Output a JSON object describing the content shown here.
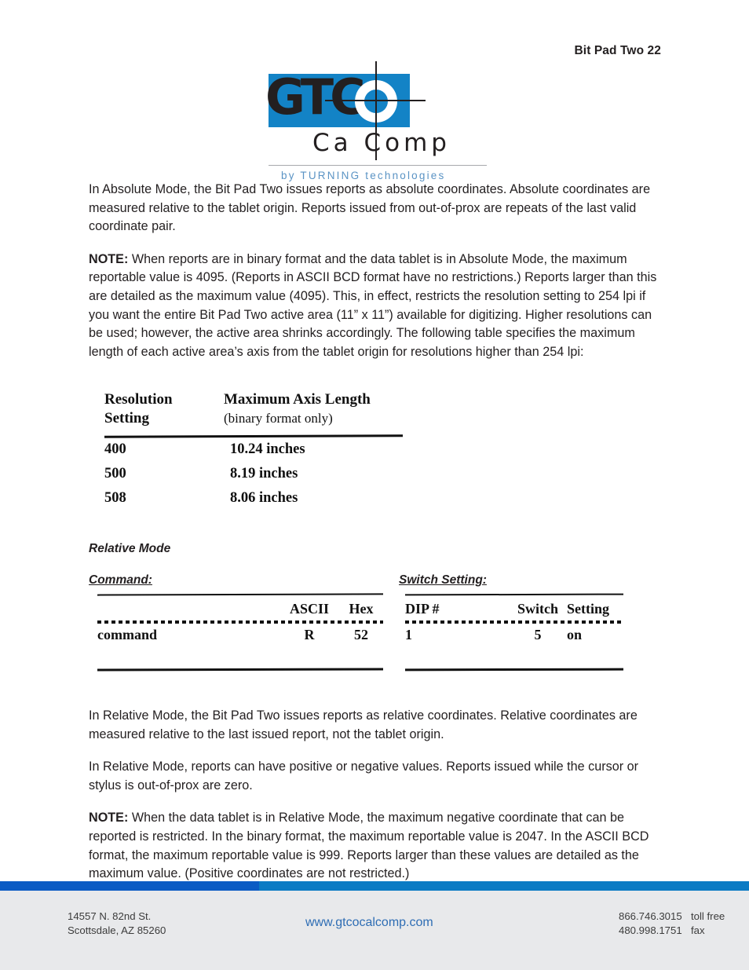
{
  "header": {
    "page_label": "Bit Pad Two 22"
  },
  "logo": {
    "wordmark": "GTC",
    "subtitle": "Ca Comp",
    "tagline_prefix": "by",
    "tagline_brand": "TURNING",
    "tagline_suffix": "technologies",
    "brand_blue": "#1383c6",
    "tagline_color": "#5a93c4"
  },
  "body": {
    "paragraph_1": "In Absolute Mode, the Bit Pad Two issues reports as absolute coordinates.  Absolute coordinates are measured relative to the tablet origin.  Reports issued from out-of-prox are repeats of the last valid coordinate pair.",
    "note_1_lead": "NOTE:",
    "note_1_text": " When reports are in binary format and the data tablet is in Absolute Mode, the maximum reportable value is 4095.  (Reports in ASCII BCD format have no restrictions.)  Reports larger than this are detailed as the maximum value (4095).  This, in effect, restricts the resolution setting to 254 lpi if you want the entire Bit Pad Two active area (11” x 11”) available for digitizing.  Higher resolutions can be used; however, the active area shrinks accordingly.  The following table specifies the maximum length of each active area’s axis from the tablet origin for resolutions higher than 254 lpi:",
    "paragraph_2": "In Relative Mode, the Bit Pad Two issues reports as relative coordinates.  Relative coordinates are measured relative to the last issued report, not the tablet origin.",
    "paragraph_3": "In Relative Mode, reports can have positive or negative values.  Reports issued while the cursor or stylus is out-of-prox are zero.",
    "note_2_lead": "NOTE:",
    "note_2_text": " When the data tablet is in Relative Mode, the maximum negative coordinate that can be reported is restricted.  In the binary format, the maximum reportable value is 2047.  In the ASCII BCD format, the maximum reportable value is 999.  Reports larger than these values are detailed as the maximum value.  (Positive coordinates are not restricted.)"
  },
  "resolution_table": {
    "header_col1_line1": "Resolution",
    "header_col1_line2": "Setting",
    "header_col2_line1": "Maximum Axis Length",
    "header_col2_line2": "(binary format only)",
    "rows": [
      {
        "setting": "400",
        "length": "10.24 inches"
      },
      {
        "setting": "500",
        "length": "8.19 inches"
      },
      {
        "setting": "508",
        "length": "8.06 inches"
      }
    ]
  },
  "sections": {
    "relative_mode_heading": "Relative Mode",
    "command_heading": "Command:",
    "switch_heading": "Switch Setting:"
  },
  "command_table": {
    "header": {
      "label": "",
      "ascii": "ASCII",
      "hex": "Hex"
    },
    "rows": [
      {
        "label": "command",
        "ascii": "R",
        "hex": "52"
      }
    ]
  },
  "switch_table": {
    "header": {
      "dip": "DIP #",
      "switch": "Switch",
      "setting": "Setting"
    },
    "rows": [
      {
        "dip": "1",
        "switch": "5",
        "setting": "on"
      }
    ]
  },
  "footer": {
    "address_line1": "14557 N. 82nd St.",
    "address_line2": "Scottsdale, AZ 85260",
    "url": "www.gtcocalcomp.com",
    "phone_1_number": "866.746.3015",
    "phone_1_label": "toll free",
    "phone_2_number": "480.998.1751",
    "phone_2_label": "fax",
    "bar_dark": "#0b5bc4",
    "bar_light": "#0b7bc4",
    "background": "#e8e9eb",
    "url_color": "#2e6db4"
  }
}
